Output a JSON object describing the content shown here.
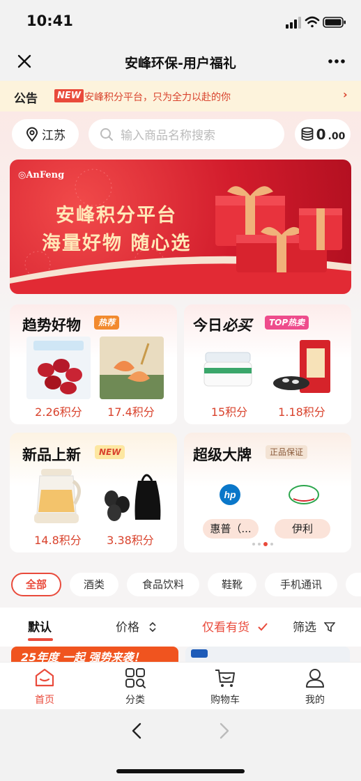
{
  "status": {
    "time": "10:41"
  },
  "nav": {
    "title": "安峰环保-用户福礼"
  },
  "notice": {
    "label": "公告",
    "badge": "NEW",
    "text": "安峰积分平台，只为全力以赴的你"
  },
  "location": "江苏",
  "search": {
    "placeholder": "输入商品名称搜索"
  },
  "points": {
    "int": "0",
    "dec": ".00"
  },
  "banner": {
    "logo": "AnFeng",
    "line1": "安峰积分平台",
    "line2": "海量好物 随心选"
  },
  "sections": {
    "trend": {
      "title": "趋势好物",
      "tag": "热荐",
      "items": [
        {
          "price": "2.26积分"
        },
        {
          "price": "17.4积分"
        }
      ]
    },
    "today": {
      "title_a": "今日",
      "title_b": "必买",
      "tag": "TOP热卖",
      "items": [
        {
          "price": "15积分"
        },
        {
          "price": "1.18积分"
        }
      ]
    },
    "newitems": {
      "title": "新品上新",
      "tag": "NEW",
      "items": [
        {
          "price": "14.8积分"
        },
        {
          "price": "3.38积分"
        }
      ]
    },
    "brands": {
      "title": "超级大牌",
      "tag": "正品保证",
      "items": [
        {
          "name": "惠普（..."
        },
        {
          "name": "伊利"
        }
      ]
    }
  },
  "categories": [
    "全部",
    "酒类",
    "食品饮料",
    "鞋靴",
    "手机通讯"
  ],
  "sort": {
    "default": "默认",
    "price": "价格",
    "instock": "仅看有货",
    "filter": "筛选"
  },
  "strip": {
    "left_text": "25年度 一起 强势来袭！"
  },
  "tabs": [
    {
      "label": "首页",
      "icon": "home-icon"
    },
    {
      "label": "分类",
      "icon": "category-icon"
    },
    {
      "label": "购物车",
      "icon": "cart-icon"
    },
    {
      "label": "我的",
      "icon": "profile-icon"
    }
  ],
  "colors": {
    "accent": "#e94a3b",
    "banner": "#d21c2c",
    "notice_bg": "#fdf3dc"
  }
}
